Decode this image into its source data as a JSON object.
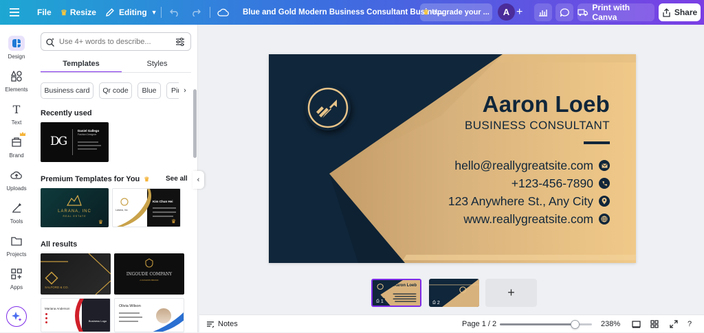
{
  "topbar": {
    "file": "File",
    "resize": "Resize",
    "editing": "Editing",
    "doc_title": "Blue and Gold Modern Business Consultant Busine...",
    "upgrade": "Upgrade your ...",
    "avatar_letter": "A",
    "print": "Print with Canva",
    "share": "Share"
  },
  "rail": {
    "items": [
      {
        "label": "Design",
        "icon": "design-icon"
      },
      {
        "label": "Elements",
        "icon": "elements-icon"
      },
      {
        "label": "Text",
        "icon": "text-icon"
      },
      {
        "label": "Brand",
        "icon": "brand-icon"
      },
      {
        "label": "Uploads",
        "icon": "uploads-icon"
      },
      {
        "label": "Tools",
        "icon": "tools-icon"
      },
      {
        "label": "Projects",
        "icon": "projects-icon"
      },
      {
        "label": "Apps",
        "icon": "apps-icon"
      }
    ]
  },
  "panel": {
    "search_placeholder": "Use 4+ words to describe...",
    "tabs": [
      "Templates",
      "Styles"
    ],
    "chips": [
      "Business card",
      "Qr code",
      "Blue",
      "Pin"
    ],
    "recently_used": "Recently used",
    "premium": "Premium Templates for You",
    "see_all": "See all",
    "all_results": "All results",
    "recent_card": {
      "name": "Daniel Gallego",
      "role": "Fashion Designer",
      "monogram": "DG"
    },
    "premium_cards": [
      {
        "brand": "LARANA, INC",
        "sub": "REAL ESTATE"
      },
      {
        "brand": "Larana, Inc.",
        "name": "Kim Chun Hei"
      }
    ],
    "result_cards": [
      {
        "brand": "SALFORD & CO."
      },
      {
        "brand": "INGOUDE COMPANY",
        "sub": "A FASHION BRAND"
      },
      {
        "name": "Mariana Anderson",
        "logo": "Business Logo"
      },
      {
        "name": "Olivia Wilson"
      }
    ]
  },
  "card": {
    "name": "Aaron Loeb",
    "title": "BUSINESS CONSULTANT",
    "email": "hello@reallygreatsite.com",
    "phone": "+123-456-7890",
    "address": "123 Anywhere St., Any City",
    "website": "www.reallygreatsite.com",
    "colors": {
      "navy": "#10263a",
      "gold": "#e8c489"
    }
  },
  "pages": {
    "thumb1": {
      "number": "1",
      "name": "Aaron Loeb"
    },
    "thumb2": {
      "number": "2"
    },
    "add": "+"
  },
  "footer": {
    "notes": "Notes",
    "page": "Page 1 / 2",
    "zoom": "238%",
    "zoom_level": 0.82
  },
  "colors": {
    "accent": "#7d2ae8"
  }
}
